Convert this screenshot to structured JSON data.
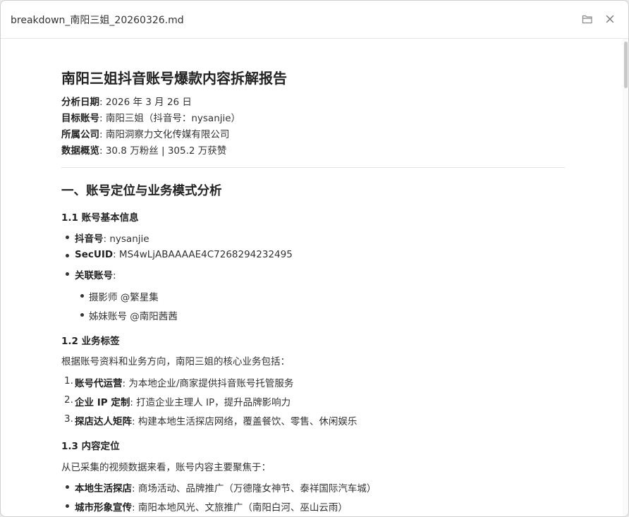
{
  "window": {
    "title": "breakdown_南阳三姐_20260326.md",
    "folder_icon": "folder-icon",
    "close_icon": "close-icon"
  },
  "doc": {
    "title": "南阳三姐抖音账号爆款内容拆解报告",
    "meta": [
      {
        "label": "分析日期",
        "value": ": 2026 年 3 月 26 日"
      },
      {
        "label": "目标账号",
        "value": ": 南阳三姐（抖音号：nysanjie）"
      },
      {
        "label": "所属公司",
        "value": ": 南阳洞察力文化传媒有限公司"
      },
      {
        "label": "数据概览",
        "value": ": 30.8 万粉丝 | 305.2 万获赞"
      }
    ],
    "section1": {
      "heading": "一、账号定位与业务模式分析",
      "s11": {
        "heading": "1.1 账号基本信息",
        "items": [
          {
            "label": "抖音号",
            "value": ": nysanjie"
          },
          {
            "label": "SecUID",
            "value": ": MS4wLjABAAAAE4C7268294232495"
          },
          {
            "label": "关联账号",
            "value": ":"
          }
        ],
        "subitems": [
          "摄影师 @繁星集",
          "姊妹账号 @南阳茜茜"
        ]
      },
      "s12": {
        "heading": "1.2 业务标签",
        "intro": "根据账号资料和业务方向，南阳三姐的核心业务包括：",
        "items": [
          {
            "num": "1.",
            "label": "账号代运营",
            "value": ": 为本地企业/商家提供抖音账号托管服务"
          },
          {
            "num": "2.",
            "label": "企业 IP 定制",
            "value": ": 打造企业主理人 IP，提升品牌影响力"
          },
          {
            "num": "3.",
            "label": "探店达人矩阵",
            "value": ": 构建本地生活探店网络，覆盖餐饮、零售、休闲娱乐"
          }
        ]
      },
      "s13": {
        "heading": "1.3 内容定位",
        "intro": "从已采集的视频数据来看，账号内容主要聚焦于：",
        "items": [
          {
            "label": "本地生活探店",
            "value": ": 商场活动、品牌推广（万德隆女神节、泰祥国际汽车城）"
          },
          {
            "label": "城市形象宣传",
            "value": ": 南阳本地风光、文旅推广（南阳白河、巫山云雨）"
          }
        ]
      }
    }
  }
}
